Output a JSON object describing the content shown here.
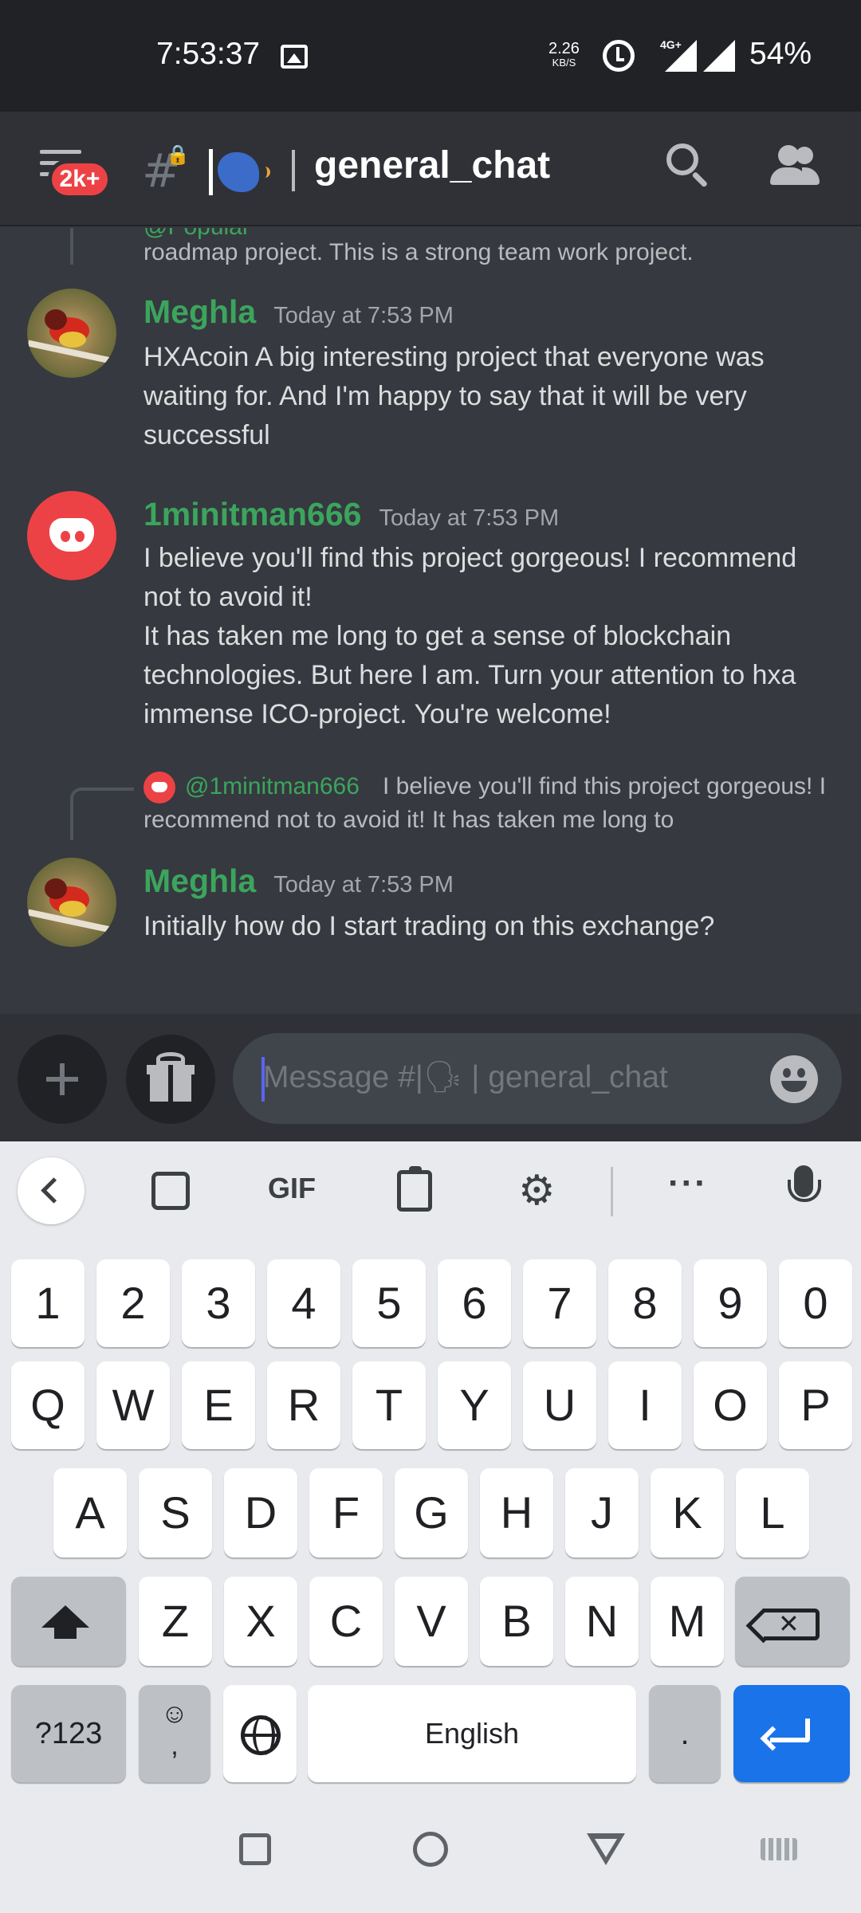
{
  "status_bar": {
    "time": "7:53:37",
    "net_speed": "2.26",
    "net_unit": "KB/S",
    "network_type": "4G+",
    "battery": "54%"
  },
  "header": {
    "unread_badge": "2k+",
    "channel_prefix": "|🗣",
    "channel_name": "general_chat"
  },
  "chat": {
    "messages": [
      {
        "type": "reply-fragment",
        "reply_mention": "@Popular",
        "text": "roadmap project. This is a strong team work project."
      },
      {
        "author": "Meghla",
        "author_color": "#3ba55d",
        "timestamp": "Today at 7:53 PM",
        "text": "HXAcoin A big interesting project that everyone was waiting for. And I'm happy to say that it will be very successful"
      },
      {
        "author": "1minitman666",
        "author_color": "#3ba55d",
        "timestamp": "Today at 7:53 PM",
        "text_line1": "I believe you'll find this project gorgeous! I recommend not to avoid it!",
        "text_line2": "It has taken me long to get a sense of blockchain technologies. But here I am. Turn your attention to hxa immense ICO-project. You're welcome!"
      },
      {
        "type": "reply",
        "reply_mention": "@1minitman666",
        "reply_text": "I believe you'll find this project gorgeous! I recommend not to avoid it! It has taken me long to"
      },
      {
        "author": "Meghla",
        "author_color": "#3ba55d",
        "timestamp": "Today at 7:53 PM",
        "text": "Initially how do I start trading on this exchange?"
      }
    ]
  },
  "composer": {
    "placeholder": "Message #|🗣 | general_chat"
  },
  "keyboard": {
    "toolbar_gif": "GIF",
    "toolbar_more": "···",
    "row_numbers": [
      "1",
      "2",
      "3",
      "4",
      "5",
      "6",
      "7",
      "8",
      "9",
      "0"
    ],
    "row_q": [
      "Q",
      "W",
      "E",
      "R",
      "T",
      "Y",
      "U",
      "I",
      "O",
      "P"
    ],
    "row_a": [
      "A",
      "S",
      "D",
      "F",
      "G",
      "H",
      "J",
      "K",
      "L"
    ],
    "row_z": [
      "Z",
      "X",
      "C",
      "V",
      "B",
      "N",
      "M"
    ],
    "symbols_key": "?123",
    "emoji_key_top": "☺",
    "emoji_key_bottom": ",",
    "space_label": "English",
    "period_key": ".",
    "enter_color": "#1a73e8"
  },
  "colors": {
    "background": "#36393f",
    "header": "#2f3136",
    "badge": "#ed4245",
    "author": "#3ba55d",
    "keyboard": "#e8eaed"
  }
}
